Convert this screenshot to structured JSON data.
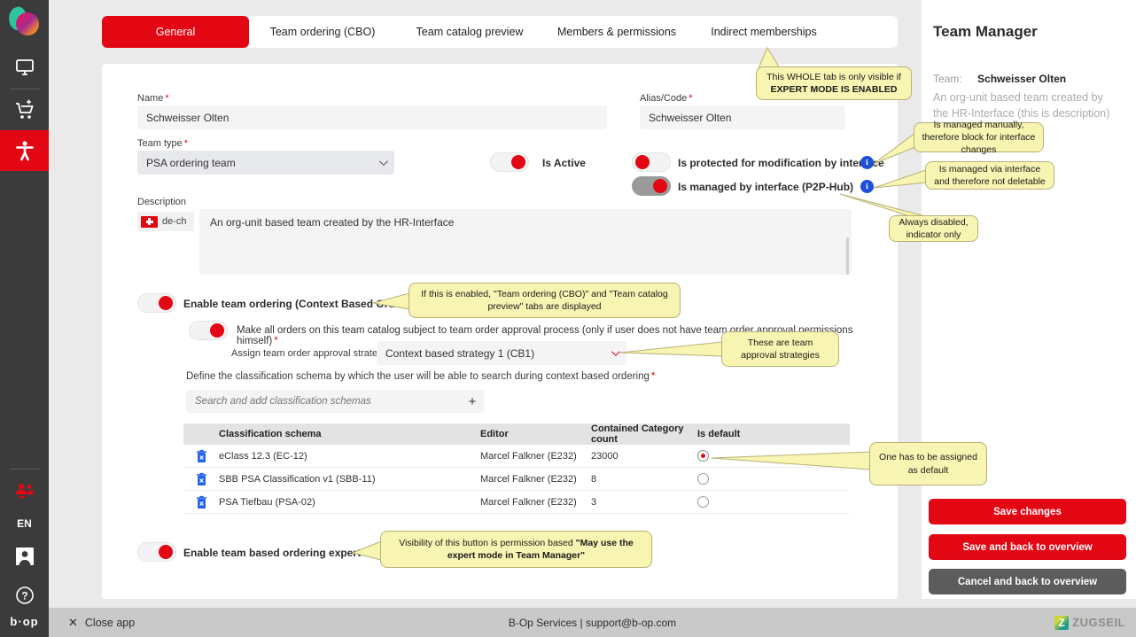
{
  "app": {
    "close_label": "Close app",
    "close_icon": "✕",
    "footer_center": "B-Op Services | support@b-op.com",
    "brand": "ZUGSEIL",
    "brand_letter": "Z",
    "language": "EN",
    "bop_logo": "b·op",
    "required_marker": "*",
    "plus_icon": "+",
    "info_glyph": "i",
    "help_glyph": "?"
  },
  "tabs": [
    {
      "label": "General"
    },
    {
      "label": "Team ordering (CBO)"
    },
    {
      "label": "Team catalog preview"
    },
    {
      "label": "Members & permissions"
    },
    {
      "label": "Indirect memberships"
    }
  ],
  "form": {
    "name_label": "Name",
    "name_value": "Schweisser Olten",
    "alias_label": "Alias/Code",
    "alias_value": "Schweisser Olten",
    "team_type_label": "Team type",
    "team_type_value": "PSA ordering team",
    "is_active_label": "Is Active",
    "protected_label": "Is protected for modification by interface",
    "managed_label": "Is managed by interface (P2P-Hub)",
    "description_label": "Description",
    "lang_code": "de-ch",
    "description_value": "An org-unit based team created by the HR-Interface",
    "enable_cbo_label": "Enable team ordering (Context Based Ordering)",
    "approval_toggle_label": "Make all orders on this team catalog subject to team order approval process (only if user does not have team order approval permissions himself)",
    "strategy_label": "Assign team order approval strategy",
    "strategy_value": "Context based strategy 1 (CB1)",
    "schema_instruction": "Define the classification schema by which the user will be able to search during context based ordering",
    "search_placeholder": "Search and add classification schemas",
    "expert_mode_label": "Enable team based ordering expert mode"
  },
  "table": {
    "headers": [
      "Classification schema",
      "Editor",
      "Contained Category count",
      "Is default"
    ],
    "rows": [
      {
        "schema": "eClass 12.3 (EC-12)",
        "editor": "Marcel Falkner (E232)",
        "count": "23000",
        "is_default": true
      },
      {
        "schema": "SBB PSA Classification v1 (SBB-11)",
        "editor": "Marcel Falkner (E232)",
        "count": "8",
        "is_default": false
      },
      {
        "schema": "PSA Tiefbau (PSA-02)",
        "editor": "Marcel Falkner (E232)",
        "count": "3",
        "is_default": false
      }
    ]
  },
  "tooltips": {
    "expert_tab_line1": "This WHOLE tab is only visible if",
    "expert_tab_line2": "EXPERT MODE IS ENABLED",
    "managed_manually": "Is managed manually, therefore block for interface changes",
    "managed_via": "Is managed via interface and therefore not deletable",
    "always_disabled": "Always disabled, indicator only",
    "cbo_enabled": "If this is enabled, \"Team ordering (CBO)\" and \"Team catalog preview\" tabs are displayed",
    "strategies": "These are team approval strategies",
    "default_radio": "One has to be assigned as default",
    "expert_visibility_prefix": "Visibility of this button is permission based ",
    "expert_visibility_bold": "\"May use the expert mode in Team Manager\""
  },
  "panel": {
    "title": "Team Manager",
    "team_label": "Team:",
    "team_name": "Schweisser Olten",
    "team_description": "An org-unit based team created by the HR-Interface (this is description)",
    "save_button": "Save changes",
    "save_back_button": "Save and back to overview",
    "cancel_button": "Cancel and back to overview"
  },
  "colors": {
    "accent_red": "#e30613",
    "info_blue": "#1d4fd7",
    "delete_blue": "#2563eb",
    "tooltip_yellow": "#f8f4b2"
  }
}
